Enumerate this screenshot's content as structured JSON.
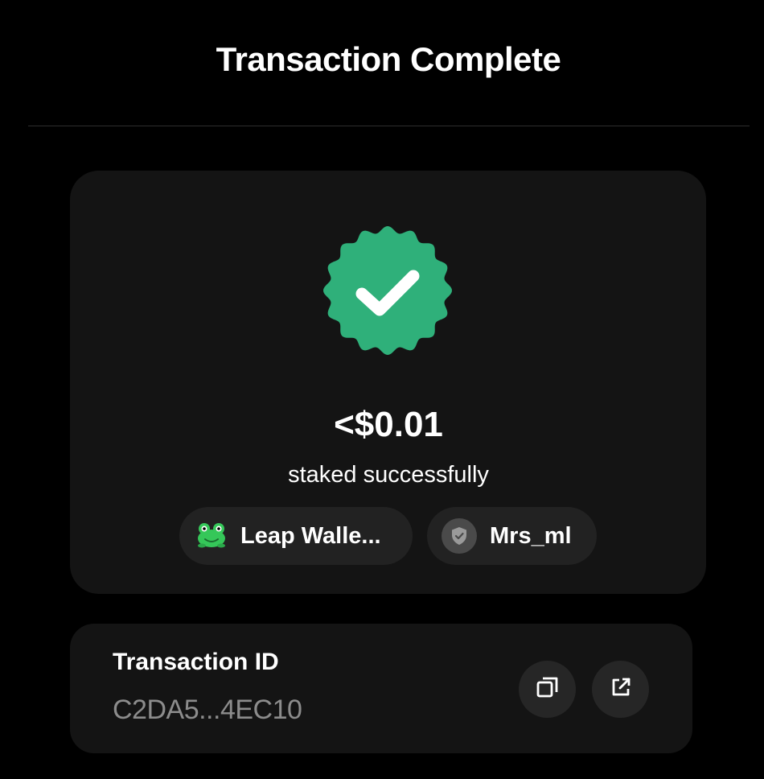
{
  "header": {
    "title": "Transaction Complete"
  },
  "summary": {
    "amount": "<$0.01",
    "status_text": "staked successfully",
    "wallet_chip": {
      "label": "Leap Walle...",
      "icon": "frog-icon"
    },
    "validator_chip": {
      "label": "Mrs_ml",
      "icon": "shield-icon"
    },
    "status_icon": "check-badge-icon"
  },
  "transaction": {
    "label": "Transaction ID",
    "id": "C2DA5...4EC10",
    "copy_icon": "copy-icon",
    "open_icon": "external-link-icon"
  },
  "colors": {
    "background": "#000000",
    "card": "#141414",
    "chip": "#222222",
    "success_green": "#2fb07a",
    "muted_text": "#8c8c8c"
  }
}
